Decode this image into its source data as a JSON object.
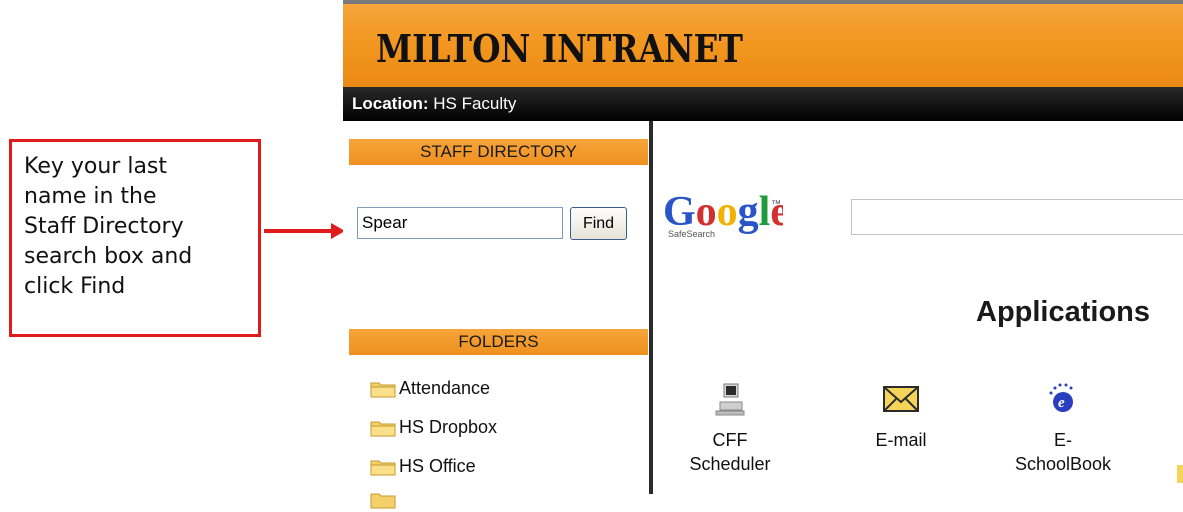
{
  "callout": {
    "text": "Key your last\nname in the\nStaff Directory\nsearch box and\nclick Find"
  },
  "header": {
    "title": "MILTON INTRANET",
    "location_label": "Location:",
    "location_value": "HS Faculty"
  },
  "staff_directory": {
    "heading": "STAFF DIRECTORY",
    "search_value": "Spear",
    "find_label": "Find"
  },
  "folders": {
    "heading": "FOLDERS",
    "items": [
      "Attendance",
      "HS Dropbox",
      "HS Office"
    ]
  },
  "google": {
    "logo_text": "Google",
    "safesearch_text": "SafeSearch",
    "search_value": ""
  },
  "applications": {
    "title": "Applications",
    "items": [
      {
        "label": "CFF\nScheduler",
        "icon": "computer-icon"
      },
      {
        "label": "E-mail",
        "icon": "envelope-icon"
      },
      {
        "label": "E-\nSchoolBook",
        "icon": "eschool-icon"
      }
    ]
  },
  "colors": {
    "accent_orange": "#f2961f",
    "callout_red": "#e01b1b",
    "location_bar": "#000000"
  }
}
